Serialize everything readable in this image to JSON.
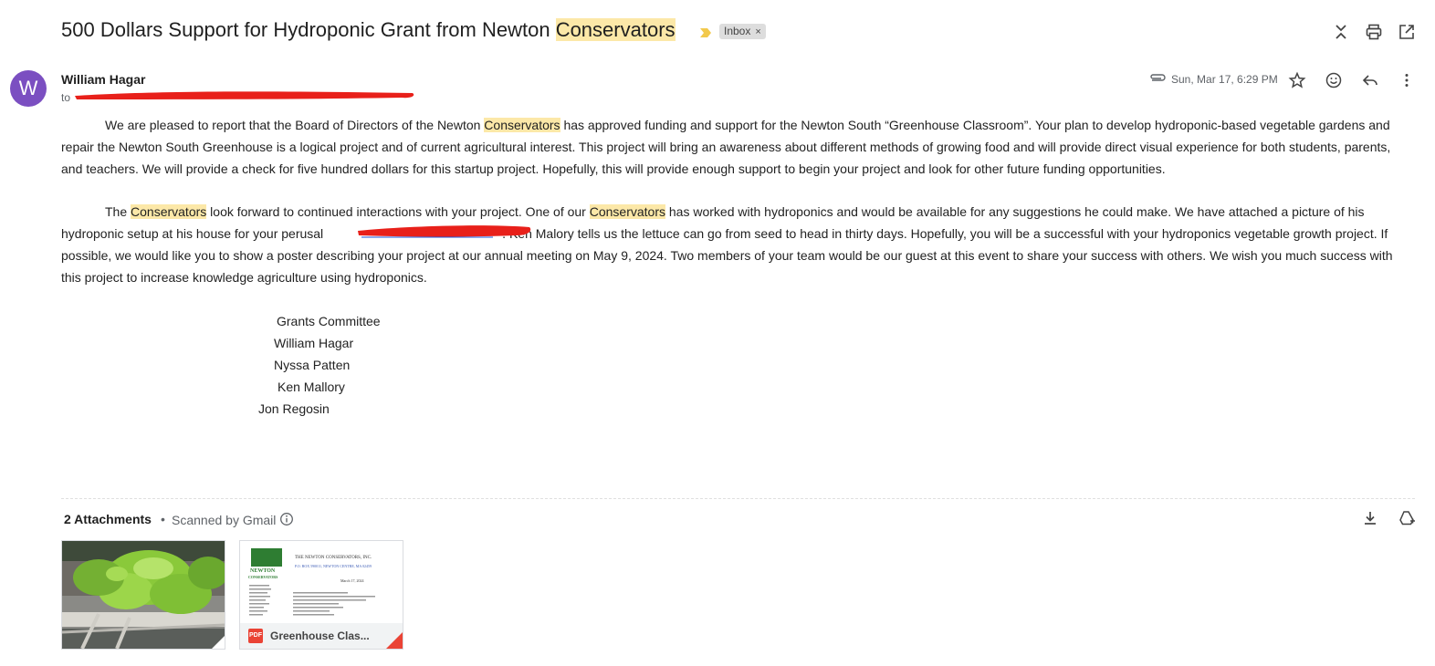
{
  "header": {
    "subject_prefix": "500 Dollars Support for Hydroponic Grant from Newton ",
    "subject_highlight": "Conservators",
    "label": "Inbox",
    "label_remove": "×"
  },
  "message": {
    "sender_initial": "W",
    "sender_name": "William Hagar",
    "to_label": "to",
    "date": "Sun, Mar 17, 6:29 PM"
  },
  "body": {
    "p1_a": "We are pleased to report that the Board of Directors of the Newton ",
    "p1_hl": "Conservators",
    "p1_b": " has approved funding and support for the Newton South “Greenhouse Classroom”. Your plan to develop hydroponic-based vegetable gardens and repair the Newton South Greenhouse is a logical project and of current agricultural interest.  This project will bring an awareness about different methods of growing food and will provide direct visual experience for both students, parents, and teachers.  We will provide a check for five hundred dollars for this startup project. Hopefully, this will provide enough support to begin your project and look for other future funding opportunities.",
    "p2_a": "The ",
    "p2_hl1": "Conservators",
    "p2_b": " look forward to continued interactions with your project.  One of our ",
    "p2_hl2": "Conservators",
    "p2_c": " has worked with hydroponics and would be available for any suggestions he could make.  We have attached a picture of his hydroponic setup at his house for your perusal",
    "p2_d": ".  Ken Malory tells us the lettuce can go from seed to head in thirty days.  Hopefully, you will be a successful with your hydroponics vegetable growth project.  If possible, we would like you to show a poster describing your project at our annual meeting on May 9, 2024.  Two members of your team would be our guest at this event to share your success with others.  We wish you much success with this project to increase knowledge agriculture using hydroponics.",
    "signature": [
      "Grants Committee",
      "William Hagar",
      "Nyssa Patten",
      "Ken Mallory",
      "Jon Regosin"
    ]
  },
  "attachments": {
    "count_label": "2 Attachments",
    "separator": "•",
    "scanned_label": "Scanned by Gmail",
    "pdf_badge": "PDF",
    "pdf_name": "Greenhouse Clas...",
    "doc_preview": {
      "org": "THE NEWTON CONSERVATORS, INC.",
      "address": "P.O. BOX 590011, NEWTON CENTRE, MA 02459",
      "date": "March 17, 2024",
      "logo_line1": "NEWTON",
      "logo_line2": "CONSERVATORS"
    }
  },
  "colors": {
    "highlight": "#fce8a8",
    "avatar": "#7b4fc1",
    "redaction": "#e8201a",
    "pdf": "#ea4335"
  }
}
